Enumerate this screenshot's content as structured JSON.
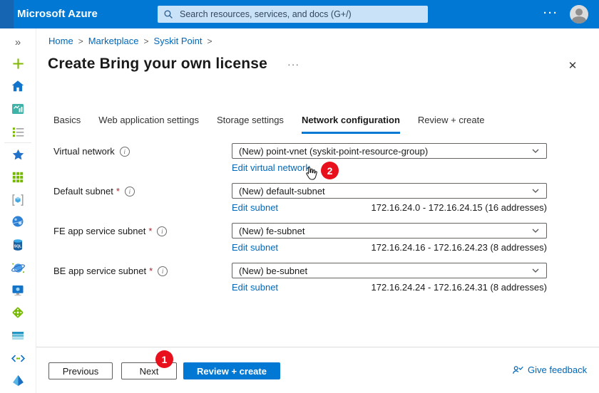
{
  "topbar": {
    "brand": "Microsoft Azure",
    "search_placeholder": "Search resources, services, and docs (G+/)",
    "more_glyph": "···"
  },
  "sidebar": {
    "items": [
      "expand",
      "create-a-resource",
      "home",
      "dashboard",
      "all-services",
      "favorites",
      "all-resources",
      "resource-groups",
      "app-services",
      "sql-databases",
      "azure-cosmos-db",
      "virtual-machines",
      "load-balancers",
      "storage-accounts",
      "virtual-networks",
      "azure-active-directory"
    ],
    "expand_glyph": "»"
  },
  "breadcrumb": {
    "items": [
      "Home",
      "Marketplace",
      "Syskit Point"
    ],
    "separator": ">"
  },
  "page": {
    "title": "Create Bring your own license",
    "more_glyph": "···",
    "close_glyph": "✕"
  },
  "tabs": {
    "items": [
      {
        "label": "Basics",
        "active": false
      },
      {
        "label": "Web application settings",
        "active": false
      },
      {
        "label": "Storage settings",
        "active": false
      },
      {
        "label": "Network configuration",
        "active": true
      },
      {
        "label": "Review + create",
        "active": false
      }
    ]
  },
  "form": {
    "rows": [
      {
        "label": "Virtual network",
        "required": false,
        "value": "(New) point-vnet (syskit-point-resource-group)",
        "edit_link": "Edit virtual network",
        "address_range": "",
        "badge": "2"
      },
      {
        "label": "Default subnet",
        "required": true,
        "value": "(New) default-subnet",
        "edit_link": "Edit subnet",
        "address_range": "172.16.24.0 - 172.16.24.15 (16 addresses)"
      },
      {
        "label": "FE app service subnet",
        "required": true,
        "value": "(New) fe-subnet",
        "edit_link": "Edit subnet",
        "address_range": "172.16.24.16 - 172.16.24.23 (8 addresses)"
      },
      {
        "label": "BE app service subnet",
        "required": true,
        "value": "(New) be-subnet",
        "edit_link": "Edit subnet",
        "address_range": "172.16.24.24 - 172.16.24.31 (8 addresses)"
      }
    ]
  },
  "footer": {
    "previous_label": "Previous",
    "next_label": "Next",
    "next_badge": "1",
    "review_create_label": "Review + create",
    "feedback_label": "Give feedback"
  },
  "colors": {
    "accent": "#0078d4",
    "badge_red": "#e8101c",
    "link": "#0067b8"
  }
}
